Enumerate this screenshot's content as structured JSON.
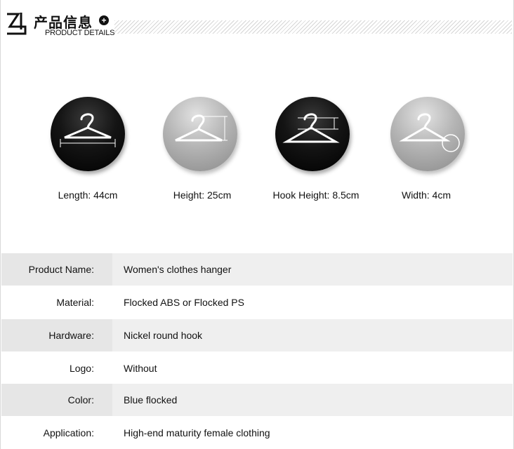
{
  "header": {
    "title_cn": "产品信息",
    "title_en": "PRODUCT DETAILS",
    "plus_glyph": "+"
  },
  "dimensions": [
    {
      "label": "Length: 44cm",
      "style": "dark",
      "icon": "hanger-length-icon"
    },
    {
      "label": "Height: 25cm",
      "style": "light",
      "icon": "hanger-height-icon"
    },
    {
      "label": "Hook Height: 8.5cm",
      "style": "dark",
      "icon": "hanger-hook-height-icon"
    },
    {
      "label": "Width: 4cm",
      "style": "light",
      "icon": "hanger-width-icon"
    }
  ],
  "specs": [
    {
      "label": "Product Name:",
      "value": "Women's clothes hanger"
    },
    {
      "label": "Material:",
      "value": "Flocked ABS or Flocked PS"
    },
    {
      "label": "Hardware:",
      "value": "Nickel round hook"
    },
    {
      "label": "Logo:",
      "value": "Without"
    },
    {
      "label": "Color:",
      "value": "Blue flocked"
    },
    {
      "label": "Application:",
      "value": "High-end maturity female clothing"
    }
  ],
  "colors": {
    "row_shade": "#efefef",
    "label_shade": "#e6e6e6",
    "dark_circle": "#111111",
    "light_circle": "#b5b5b5"
  }
}
